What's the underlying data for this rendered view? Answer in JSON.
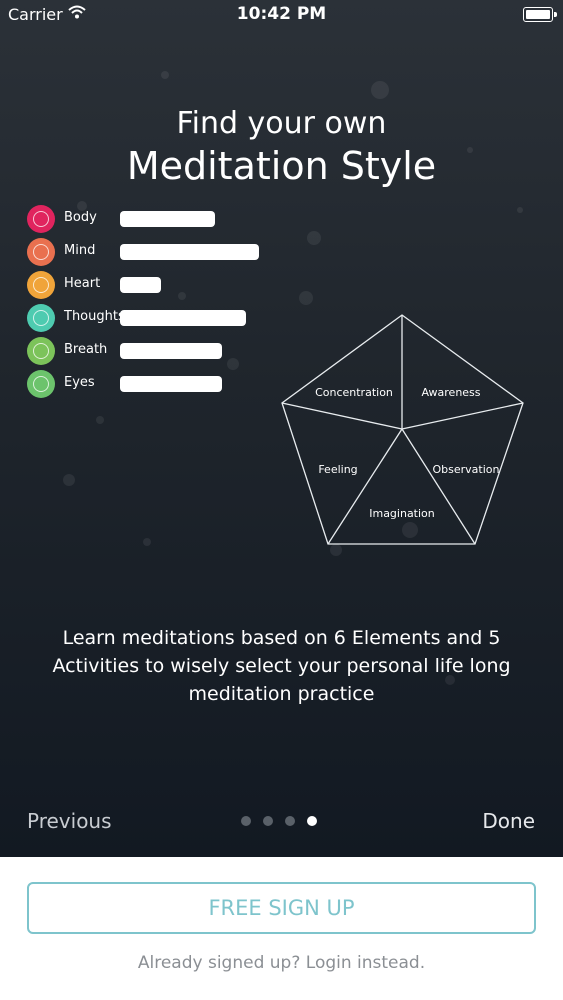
{
  "status_bar": {
    "carrier": "Carrier",
    "time": "10:42 PM"
  },
  "header": {
    "title_line1": "Find your own",
    "title_line2": "Meditation Style"
  },
  "elements": [
    {
      "label": "Body",
      "color": "#e0245e",
      "level": 0.28
    },
    {
      "label": "Mind",
      "color": "#e9704f",
      "level": 0.41
    },
    {
      "label": "Heart",
      "color": "#f0a43a",
      "level": 0.12
    },
    {
      "label": "Thoughts",
      "color": "#4ecbb0",
      "level": 0.37
    },
    {
      "label": "Breath",
      "color": "#7cc35a",
      "level": 0.3
    },
    {
      "label": "Eyes",
      "color": "#6cc36c",
      "level": 0.3
    }
  ],
  "activities": {
    "concentration": "Concentration",
    "awareness": "Awareness",
    "feeling": "Feeling",
    "observation": "Observation",
    "imagination": "Imagination"
  },
  "description": "Learn meditations based on 6 Elements and 5 Activities to wisely select your personal life long meditation practice",
  "nav": {
    "previous": "Previous",
    "done": "Done",
    "page_count": 4,
    "current_page": 4
  },
  "signup": {
    "button_label": "FREE SIGN UP",
    "login_text": "Already signed up? Login instead.",
    "accent": "#7ec4cc"
  }
}
